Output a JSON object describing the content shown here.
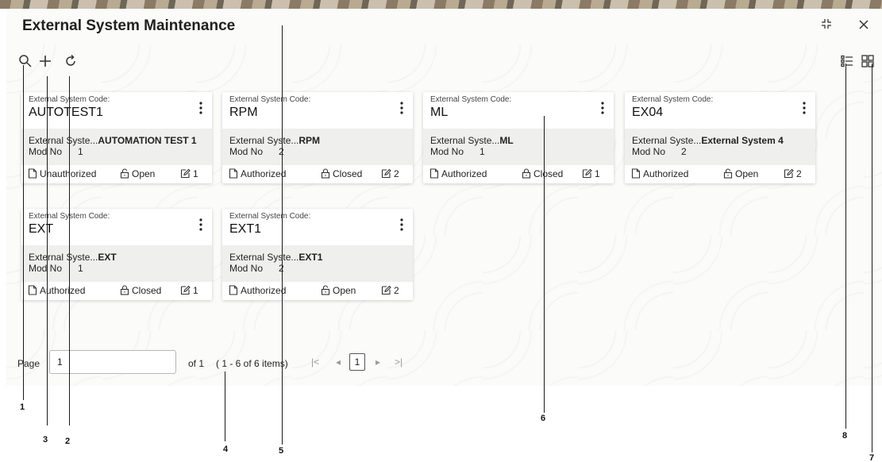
{
  "window": {
    "title": "External System Maintenance"
  },
  "toolbar": {
    "icons": [
      "search-icon",
      "add-icon",
      "refresh-icon"
    ]
  },
  "view_toggle": {
    "icons": [
      "list-view-icon",
      "tile-view-icon"
    ]
  },
  "card_labels": {
    "code_caption": "External System Code:",
    "name_label": "External Syste...",
    "mod_label": "Mod No"
  },
  "cards": [
    {
      "code": "AUTOTEST1",
      "name": "AUTOMATION TEST 1",
      "mod": "1",
      "auth": "Unauthorized",
      "status": "Open",
      "edits": "1"
    },
    {
      "code": "RPM",
      "name": "RPM",
      "mod": "2",
      "auth": "Authorized",
      "status": "Closed",
      "edits": "2"
    },
    {
      "code": "ML",
      "name": "ML",
      "mod": "1",
      "auth": "Authorized",
      "status": "Closed",
      "edits": "1"
    },
    {
      "code": "EX04",
      "name": "External System 4",
      "mod": "2",
      "auth": "Authorized",
      "status": "Open",
      "edits": "2"
    },
    {
      "code": "EXT",
      "name": "EXT",
      "mod": "1",
      "auth": "Authorized",
      "status": "Closed",
      "edits": "1"
    },
    {
      "code": "EXT1",
      "name": "EXT1",
      "mod": "2",
      "auth": "Authorized",
      "status": "Open",
      "edits": "2"
    }
  ],
  "pagination": {
    "page_label": "Page",
    "page_value": "1",
    "of_label": "of 1",
    "items_label": "( 1 - 6 of 6 items)",
    "current_page": "1",
    "first": "|<",
    "prev": "◂",
    "next": "▸",
    "last": ">|"
  },
  "callouts": [
    "1",
    "2",
    "3",
    "4",
    "5",
    "6",
    "7",
    "8"
  ]
}
